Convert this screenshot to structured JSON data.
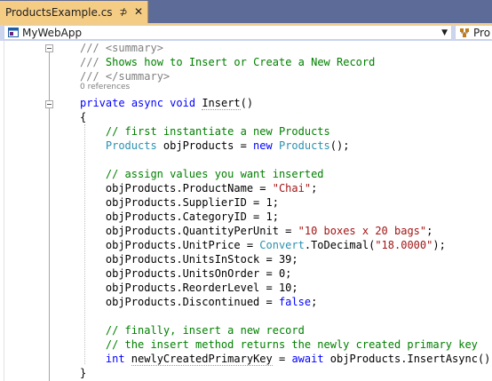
{
  "tab": {
    "title": "ProductsExample.cs",
    "pin_glyph": "⊅",
    "close_glyph": "✕"
  },
  "navbar": {
    "project": "MyWebApp",
    "member_partial": "Pro"
  },
  "editor": {
    "codelens": "0 references",
    "lines": [
      {
        "indent": 0,
        "tokens": [
          {
            "t": "/// ",
            "c": "doc"
          },
          {
            "t": "<summary>",
            "c": "doc"
          }
        ]
      },
      {
        "indent": 0,
        "tokens": [
          {
            "t": "/// ",
            "c": "doc"
          },
          {
            "t": "Shows how to Insert or Create a New Record",
            "c": "comment"
          }
        ]
      },
      {
        "indent": 0,
        "tokens": [
          {
            "t": "/// ",
            "c": "doc"
          },
          {
            "t": "</summary>",
            "c": "doc"
          }
        ]
      },
      {
        "indent": 0,
        "tokens": [
          {
            "t": "private",
            "c": "keyword"
          },
          {
            "t": " ",
            "c": "plain"
          },
          {
            "t": "async",
            "c": "keyword"
          },
          {
            "t": " ",
            "c": "plain"
          },
          {
            "t": "void",
            "c": "keyword"
          },
          {
            "t": " ",
            "c": "plain"
          },
          {
            "t": "Insert",
            "c": "plain",
            "squiggle": true
          },
          {
            "t": "()",
            "c": "plain"
          }
        ]
      },
      {
        "indent": 0,
        "tokens": [
          {
            "t": "{",
            "c": "plain"
          }
        ]
      },
      {
        "indent": 4,
        "tokens": [
          {
            "t": "// first instantiate a new Products",
            "c": "comment"
          }
        ]
      },
      {
        "indent": 4,
        "tokens": [
          {
            "t": "Products",
            "c": "type"
          },
          {
            "t": " objProducts = ",
            "c": "plain"
          },
          {
            "t": "new",
            "c": "keyword"
          },
          {
            "t": " ",
            "c": "plain"
          },
          {
            "t": "Products",
            "c": "type"
          },
          {
            "t": "();",
            "c": "plain"
          }
        ]
      },
      {
        "indent": 0,
        "tokens": []
      },
      {
        "indent": 4,
        "tokens": [
          {
            "t": "// assign values you want inserted",
            "c": "comment"
          }
        ]
      },
      {
        "indent": 4,
        "tokens": [
          {
            "t": "objProducts.ProductName = ",
            "c": "plain"
          },
          {
            "t": "\"Chai\"",
            "c": "string"
          },
          {
            "t": ";",
            "c": "plain"
          }
        ]
      },
      {
        "indent": 4,
        "tokens": [
          {
            "t": "objProducts.SupplierID = 1;",
            "c": "plain"
          }
        ]
      },
      {
        "indent": 4,
        "tokens": [
          {
            "t": "objProducts.CategoryID = 1;",
            "c": "plain"
          }
        ]
      },
      {
        "indent": 4,
        "tokens": [
          {
            "t": "objProducts.QuantityPerUnit = ",
            "c": "plain"
          },
          {
            "t": "\"10 boxes x 20 bags\"",
            "c": "string"
          },
          {
            "t": ";",
            "c": "plain"
          }
        ]
      },
      {
        "indent": 4,
        "tokens": [
          {
            "t": "objProducts.UnitPrice = ",
            "c": "plain"
          },
          {
            "t": "Convert",
            "c": "type"
          },
          {
            "t": ".ToDecimal(",
            "c": "plain"
          },
          {
            "t": "\"18.0000\"",
            "c": "string"
          },
          {
            "t": ");",
            "c": "plain"
          }
        ]
      },
      {
        "indent": 4,
        "tokens": [
          {
            "t": "objProducts.UnitsInStock = 39;",
            "c": "plain"
          }
        ]
      },
      {
        "indent": 4,
        "tokens": [
          {
            "t": "objProducts.UnitsOnOrder = 0;",
            "c": "plain"
          }
        ]
      },
      {
        "indent": 4,
        "tokens": [
          {
            "t": "objProducts.ReorderLevel = 10;",
            "c": "plain"
          }
        ]
      },
      {
        "indent": 4,
        "tokens": [
          {
            "t": "objProducts.Discontinued = ",
            "c": "plain"
          },
          {
            "t": "false",
            "c": "keyword"
          },
          {
            "t": ";",
            "c": "plain"
          }
        ]
      },
      {
        "indent": 0,
        "tokens": []
      },
      {
        "indent": 4,
        "tokens": [
          {
            "t": "// finally, insert a new record",
            "c": "comment"
          }
        ]
      },
      {
        "indent": 4,
        "tokens": [
          {
            "t": "// the insert method returns the newly created primary key",
            "c": "comment"
          }
        ]
      },
      {
        "indent": 4,
        "tokens": [
          {
            "t": "int",
            "c": "keyword"
          },
          {
            "t": " ",
            "c": "plain"
          },
          {
            "t": "newlyCreatedPrimaryKey",
            "c": "plain",
            "squiggle": true
          },
          {
            "t": " = ",
            "c": "plain"
          },
          {
            "t": "await",
            "c": "keyword"
          },
          {
            "t": " objProducts.InsertAsync();",
            "c": "plain"
          }
        ]
      },
      {
        "indent": 0,
        "tokens": [
          {
            "t": "}",
            "c": "plain"
          }
        ]
      }
    ]
  },
  "colors": {
    "tab_active": "#f5cc84",
    "chrome": "#5d6b99",
    "nav_bar": "#ccd5f0",
    "keyword": "#0000ff",
    "type": "#2b91af",
    "string": "#a31515",
    "comment": "#008000",
    "doc": "#808080"
  },
  "icons": {
    "project": "csharp-project-icon",
    "member": "class-icon"
  }
}
